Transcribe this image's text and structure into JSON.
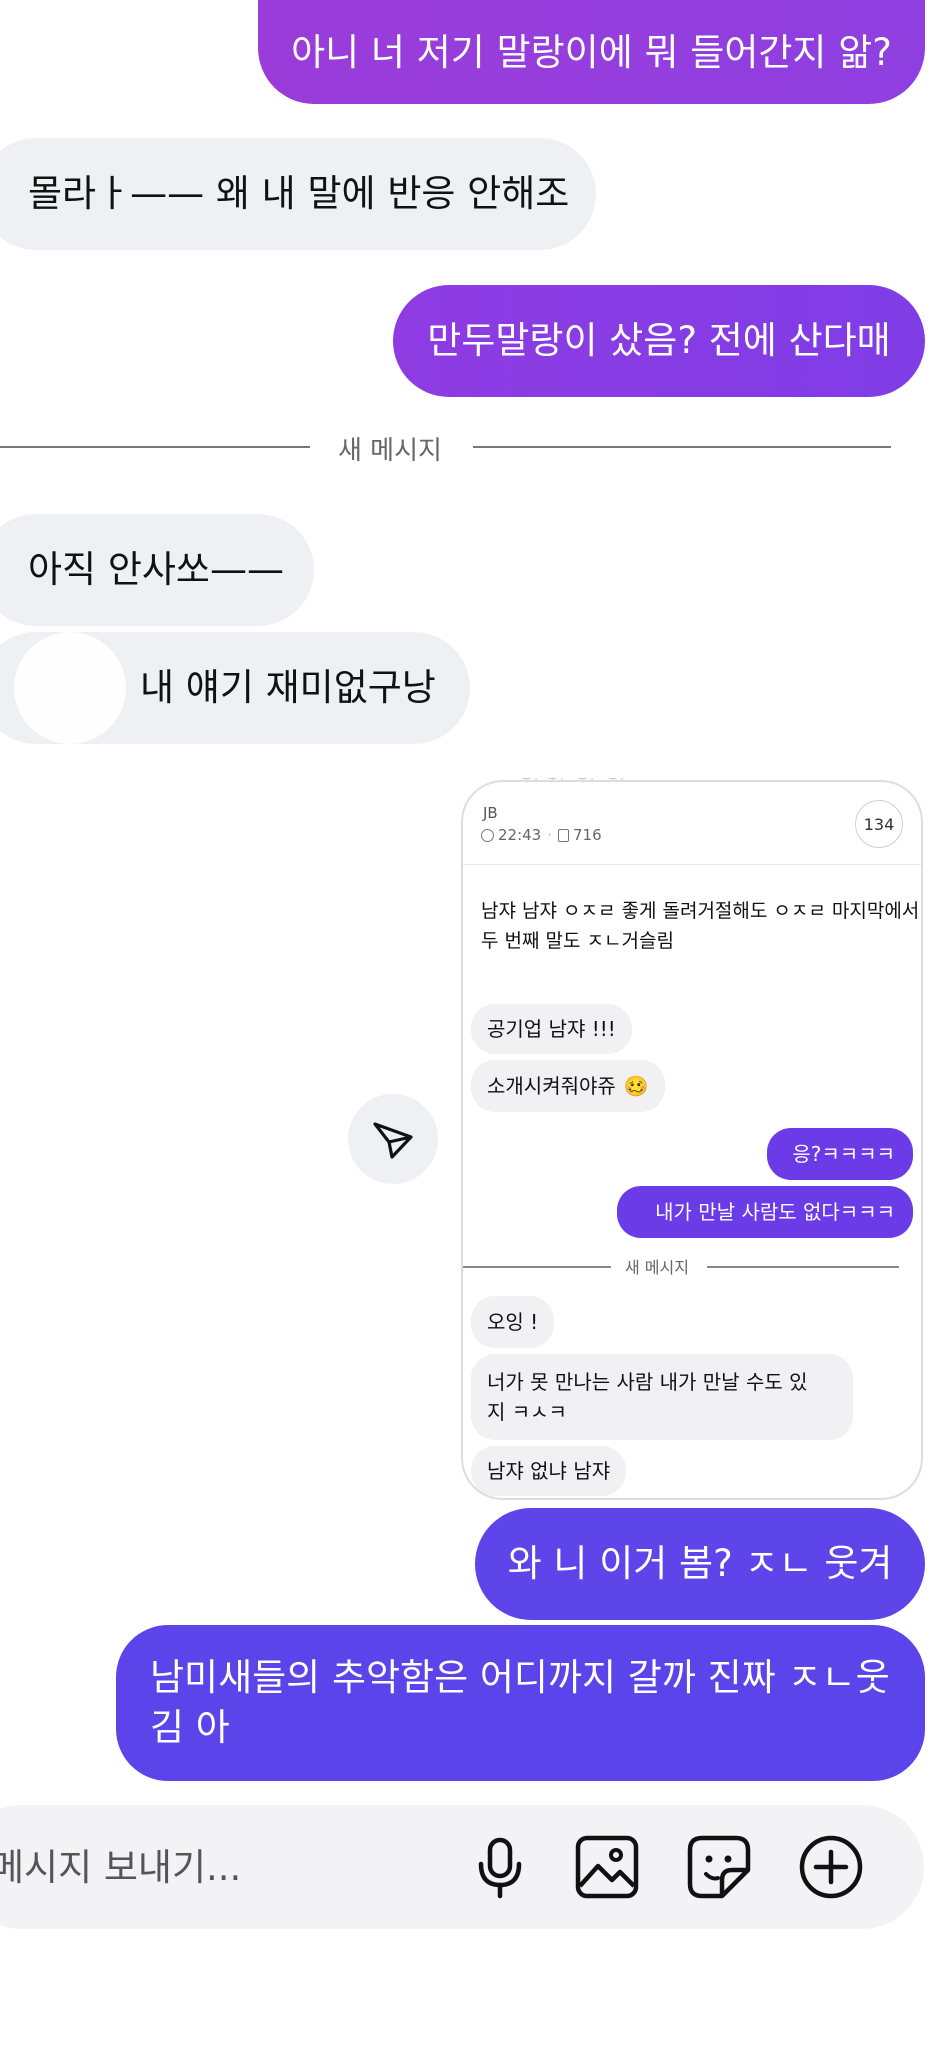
{
  "messages": [
    {
      "id": "m1",
      "side": "sent",
      "text": "아니 너 저기 말랑이에 뭐 들어간지 앎?"
    },
    {
      "id": "m2",
      "side": "recv",
      "text": "몰라ㅏ—— 왜 내 말에 반응 안해조"
    },
    {
      "id": "m3",
      "side": "sent",
      "text": "만두말랑이 샀음? 전에 산다매"
    },
    {
      "id": "m4",
      "side": "recv",
      "text": "아직 안사쏘——"
    },
    {
      "id": "m5",
      "side": "recv",
      "text": "내 얘기 재미없구낭"
    },
    {
      "id": "m6",
      "side": "sent",
      "text": "와 니 이거 봄? ㅈㄴ 웃겨"
    },
    {
      "id": "m7",
      "side": "sent",
      "line1": "남미새들의 추악함은 어디까지 갈까 진짜 ㅈㄴ웃",
      "line2": "김 아"
    }
  ],
  "divider": {
    "label": "새 메시지"
  },
  "shared_post": {
    "author": "JB",
    "time": "22:43",
    "views": "716",
    "count": "134",
    "body_line1": "남쟈 남쟈 ㅇㅈㄹ 좋게 돌려거절해도 ㅇㅈㄹ 마지막에서",
    "body_line2": "두 번째 말도 ㅈㄴ거슬림",
    "chat": {
      "recv1": "공기업 남쟈 !!!",
      "recv2": "소개시켜줘야쥬",
      "recv2_emoji": "🥴",
      "sent1": "응?ㅋㅋㅋㅋ",
      "sent2": "내가 만날 사람도 없다ㅋㅋㅋ",
      "divider": "새 메시지",
      "recv3": "오잉 !",
      "recv4_line1": "너가 못 만나는 사람 내가 만날 수도 있",
      "recv4_line2": "지 ㅋㅅㅋ",
      "recv5": "남쟈 없냐 남쟈"
    }
  },
  "input": {
    "placeholder": "메시지 보내기..."
  },
  "icons": {
    "share": "send-icon",
    "mic": "microphone-icon",
    "gallery": "image-icon",
    "sticker": "sticker-icon",
    "add": "plus-circle-icon"
  },
  "colors": {
    "sent_purple_top": "#9b3fd8",
    "sent_purple_mid": "#7d3de6",
    "sent_indigo": "#5b45ea",
    "received_bg": "#eff0f4",
    "card_sent": "#6a3be6"
  }
}
